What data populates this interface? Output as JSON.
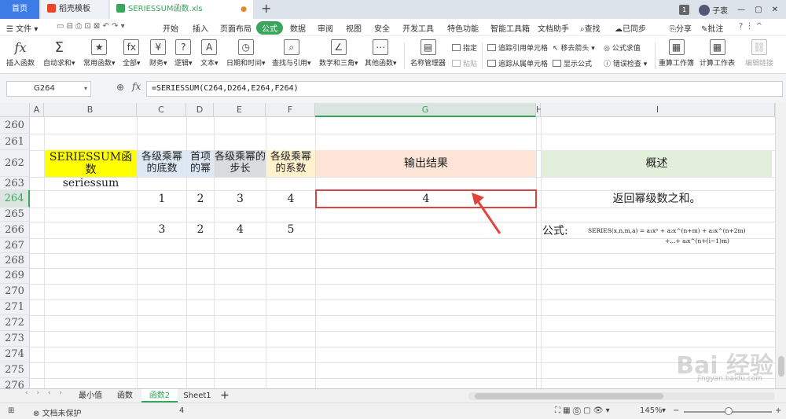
{
  "titlebar": {
    "tabs": [
      {
        "label": "首页",
        "icon": ""
      },
      {
        "label": "稻壳模板",
        "icon": "docer-icon"
      },
      {
        "label": "SERIESSUM函数.xls",
        "icon": "spreadsheet-icon"
      }
    ],
    "add_label": "+",
    "window_count": "1",
    "user": "子衷",
    "controls": [
      "—",
      "▢",
      "✕"
    ]
  },
  "menubar": {
    "file": "文件",
    "items": [
      "开始",
      "插入",
      "页面布局",
      "公式",
      "数据",
      "审阅",
      "视图",
      "安全",
      "开发工具",
      "特色功能",
      "智能工具箱",
      "文档助手"
    ],
    "search": "查找",
    "right": [
      "已同步",
      "分享",
      "批注"
    ]
  },
  "ribbon": {
    "big": [
      "插入函数",
      "自动求和",
      "常用函数",
      "全部",
      "财务",
      "逻辑",
      "文本",
      "日期和时间",
      "查找与引用",
      "数学和三角",
      "其他函数",
      "名称管理器"
    ],
    "small": [
      "指定",
      "粘贴",
      "追踪引用单元格",
      "追踪从属单元格",
      "移去箭头",
      "显示公式",
      "公式求值",
      "错误检查"
    ],
    "right": [
      "重算工作簿",
      "计算工作表",
      "编辑链接"
    ]
  },
  "formula_bar": {
    "name_box": "G264",
    "fx": "fx",
    "formula": "=SERIESSUM(C264,D264,E264,F264)"
  },
  "grid": {
    "columns": [
      "A",
      "B",
      "C",
      "D",
      "E",
      "F",
      "G",
      "H",
      "I"
    ],
    "rows": [
      "260",
      "261",
      "262",
      "263",
      "264",
      "265",
      "266",
      "267",
      "268",
      "269",
      "270",
      "271",
      "272",
      "273",
      "274",
      "275",
      "276"
    ],
    "header_row": {
      "B": "SERIESSUM函数",
      "C": "各级乘幂的底数",
      "D": "首项的幂",
      "E": "各级乘幂的步长",
      "F": "各级乘幂的系数",
      "G": "输出结果",
      "I": "概述"
    },
    "B263": "seriessum",
    "row264": {
      "C": "1",
      "D": "2",
      "E": "3",
      "F": "4",
      "G": "4",
      "I": "返回幂级数之和。"
    },
    "row266": {
      "C": "3",
      "D": "2",
      "E": "4",
      "F": "5"
    },
    "formula_label": "公式:",
    "formula_line1": "SERIES(x,n,m,a) = a₁xⁿ + a₂x^(n+m) + a₃x^(n+2m)",
    "formula_line2": "+...+ aᵢx^(n+(i−1)m)",
    "colors": {
      "yellow": "#ffff00",
      "blue": "#dde8f4",
      "gray": "#d9dcdf",
      "cream": "#fff2cc",
      "peach": "#fce4d6",
      "green": "#e2efda",
      "highlight": "#d64545"
    }
  },
  "sheets": [
    "最小值",
    "函数",
    "函数2",
    "Sheet1"
  ],
  "sheet_add": "+",
  "status": {
    "protect": "文档未保护",
    "value": "4",
    "zoom": "145%"
  },
  "watermark": {
    "text": "Bai 经验",
    "url": "jingyan.baidu.com"
  }
}
